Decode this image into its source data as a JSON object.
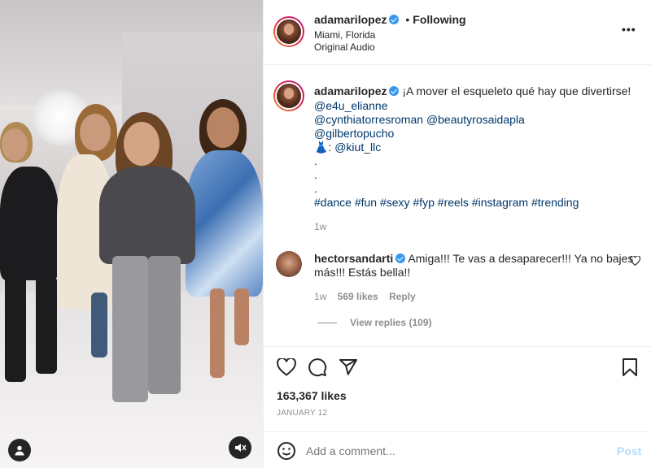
{
  "post": {
    "username": "adamarilopez",
    "follow_status": "Following",
    "location": "Miami, Florida",
    "audio": "Original Audio",
    "more_menu": "•••"
  },
  "caption": {
    "username": "adamarilopez",
    "text": "¡A mover el esqueleto qué hay que divertirse!",
    "mentions": [
      "@e4u_elianne",
      "@cynthiatorresroman",
      "@beautyrosaidapla",
      "@gilbertopucho",
      "@kiut_llc"
    ],
    "dress_emoji": "👗",
    "dress_sep": ":",
    "dots": [
      ".",
      ".",
      "."
    ],
    "hashtags": [
      "#dance",
      "#fun",
      "#sexy",
      "#fyp",
      "#reels",
      "#instagram",
      "#trending"
    ],
    "time": "1w"
  },
  "comment": {
    "username": "hectorsandarti",
    "text_line1": "Amiga!!! Te vas a desaparecer!!! Ya no bajes",
    "text_line2": "más!!! Estás bella!!",
    "time": "1w",
    "likes": "569 likes",
    "reply": "Reply",
    "view_replies": "View replies (109)"
  },
  "actions": {
    "likes": "163,367 likes",
    "date": "JANUARY 12"
  },
  "comment_box": {
    "placeholder": "Add a comment...",
    "post_label": "Post"
  },
  "icons": {
    "like": "heart-icon",
    "comment": "speech-bubble-icon",
    "share": "paper-plane-icon",
    "save": "bookmark-icon",
    "emoji": "smiley-icon",
    "mute": "speaker-muted-icon",
    "tags": "user-tag-icon",
    "comment_like": "heart-icon"
  },
  "colors": {
    "accent": "#0095f6",
    "verified": "#3897f0",
    "link": "#00376b",
    "secondary": "#8e8e8e"
  }
}
